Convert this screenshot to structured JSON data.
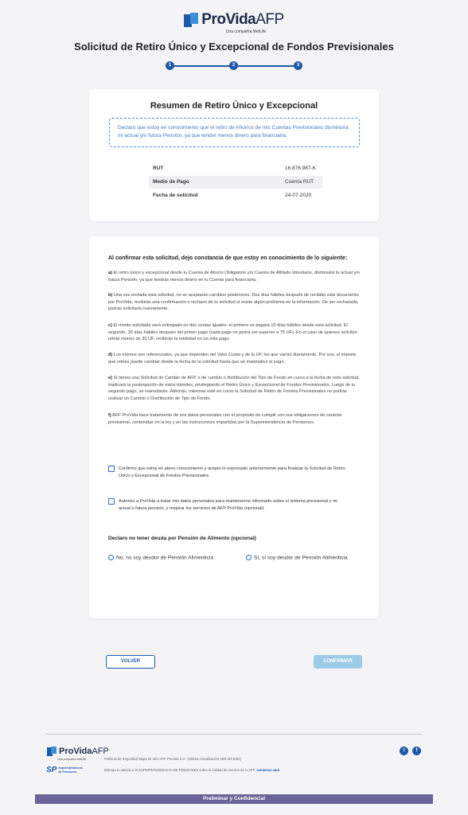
{
  "brand": {
    "name_main": "ProVida",
    "name_afp": "AFP",
    "tagline": "Una compañía MetLife"
  },
  "page_title": "Solicitud de Retiro Único y Excepcional de Fondos Previsionales",
  "steps": [
    "1",
    "2",
    "3"
  ],
  "summary": {
    "title": "Resumen de Retiro Único y Excepcional",
    "notice": "Declaro que estoy en conocimiento que el retiro de Ahorros de mis Cuentas Previsionales disminuirá mi actual y/o futura Pensión, ya que tendré menos dinero para financiarla.",
    "rows": [
      {
        "label": "RUT",
        "value": "16.876.987-K"
      },
      {
        "label": "Medio de Pago",
        "value": "Cuenta RUT"
      },
      {
        "label": "Fecha de solicitud",
        "value": "24-07-2020"
      }
    ]
  },
  "terms": {
    "intro": "Al confirmar esta solicitud, dejo constancia de que estoy en conocimiento de lo siguiente:",
    "items": [
      {
        "letter": "a)",
        "text": "El retiro único y excepcional desde tu Cuenta de Ahorro Obligatorio y/o Cuenta de Afiliado Voluntario, disminuirá tu actual y/o futura Pensión, ya que tendrás menos dinero en tu Cuenta para financiarla."
      },
      {
        "letter": "b)",
        "text": "Una vez enviada esta solicitud, no se aceptarán cambios posteriores. Dos días hábiles después de recibido este documento por ProVida, recibirás una confirmación o rechazo de tu solicitud si existe algún problema en la información. De ser rechazada, podrás solicitarla nuevamente."
      },
      {
        "letter": "c)",
        "text": "El monto solicitado será entregado en dos cuotas iguales: el primero se pagará 10 días hábiles desde esta solicitud. El segundo, 30 días hábiles después del primer pago (cada pago no podrá ser superior a 75 UF). En el caso de quienes soliciten retirar menos de 35 UF, recibirán la totalidad en un solo pago."
      },
      {
        "letter": "d)",
        "text": "Los montos son referenciales, ya que dependen del Valor Cuota y de la UF, los que varían diariamente. Por eso, el importe que retires puede cambiar desde la fecha de la solicitud hasta que se materialice el pago."
      },
      {
        "letter": "e)",
        "text": "Si tienes una Solicitud de Cambio de AFP, o de cambio o distribución del Tipo de Fondo en curso a la fecha de esta solicitud, implicará la postergación de estos trámites, privilegiando el Retiro Único y Excepcional de Fondos Previsionales. Luego de tu segundo pago, se reanudarán. Además, mientras esté en curso la Solicitud de Retiro de Fondos Previsionales no podrás realizar un Cambio o Distribución de Tipo de Fondo."
      },
      {
        "letter": "f)",
        "text": "AFP ProVida hace tratamiento de mis datos personales con el propósito de cumplir con sus obligaciones de carácter previsional, contenidas en la ley y en las instrucciones impartidas por la Superintendencia de Pensiones."
      }
    ],
    "checkbox1": "Confirmo que estoy en pleno conocimiento y acepto lo expresado anteriormente para finalizar la Solicitud de Retiro Único y Excepcional de Fondos Previsionales.",
    "checkbox2": "Autorizo a ProVida a tratar mis datos personales para mantenerme informado sobre el sistema previsional y mi actual o futura pensión, y mejorar los servicios de AFP ProVida (opcional).",
    "alimony_title": "Declaro no tener deuda por Pensión de Alimento (opcional)",
    "radio_no": "No, no soy deudor de Pensión Alimenticia",
    "radio_yes": "Sí, sí soy deudor de Pensión Alimenticia"
  },
  "buttons": {
    "back": "VOLVER",
    "confirm": "CONFIRMAR"
  },
  "footer": {
    "links": "Políticas de Seguridad  Mapa de Sitio  AFP ProVida S.A. -[Última Actualización Abril del 2020]",
    "sp_name": "SP",
    "sp_full_1": "Superintendencia",
    "sp_full_2": "de Pensiones",
    "sp_text": "Entrega tu opinión a la SUPERINTENDENCIA DE PENSIONES sobre la calidad de servicio de tu AFP.",
    "sp_link": "comienza aquí",
    "twitter": "t",
    "facebook": "f"
  },
  "banner": "Preliminar y Confidencial"
}
